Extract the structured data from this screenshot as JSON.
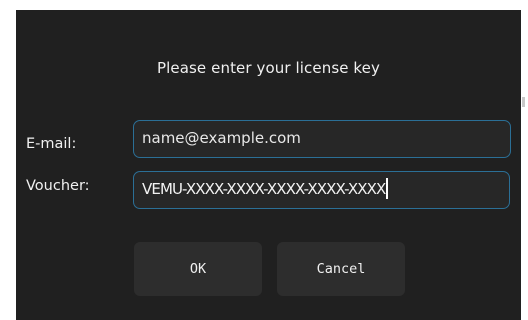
{
  "dialog": {
    "prompt": "Please enter your license key",
    "email": {
      "label": "E-mail:",
      "placeholder": "name@example.com"
    },
    "voucher": {
      "label": "Voucher:",
      "value": "VEMU-XXXX-XXXX-XXXX-XXXX-XXXX"
    },
    "buttons": {
      "ok": "OK",
      "cancel": "Cancel"
    }
  },
  "colors": {
    "background": "#202020",
    "input_border": "#2b6f96",
    "button": "#2d2d2d",
    "text": "#f0f0f0"
  }
}
